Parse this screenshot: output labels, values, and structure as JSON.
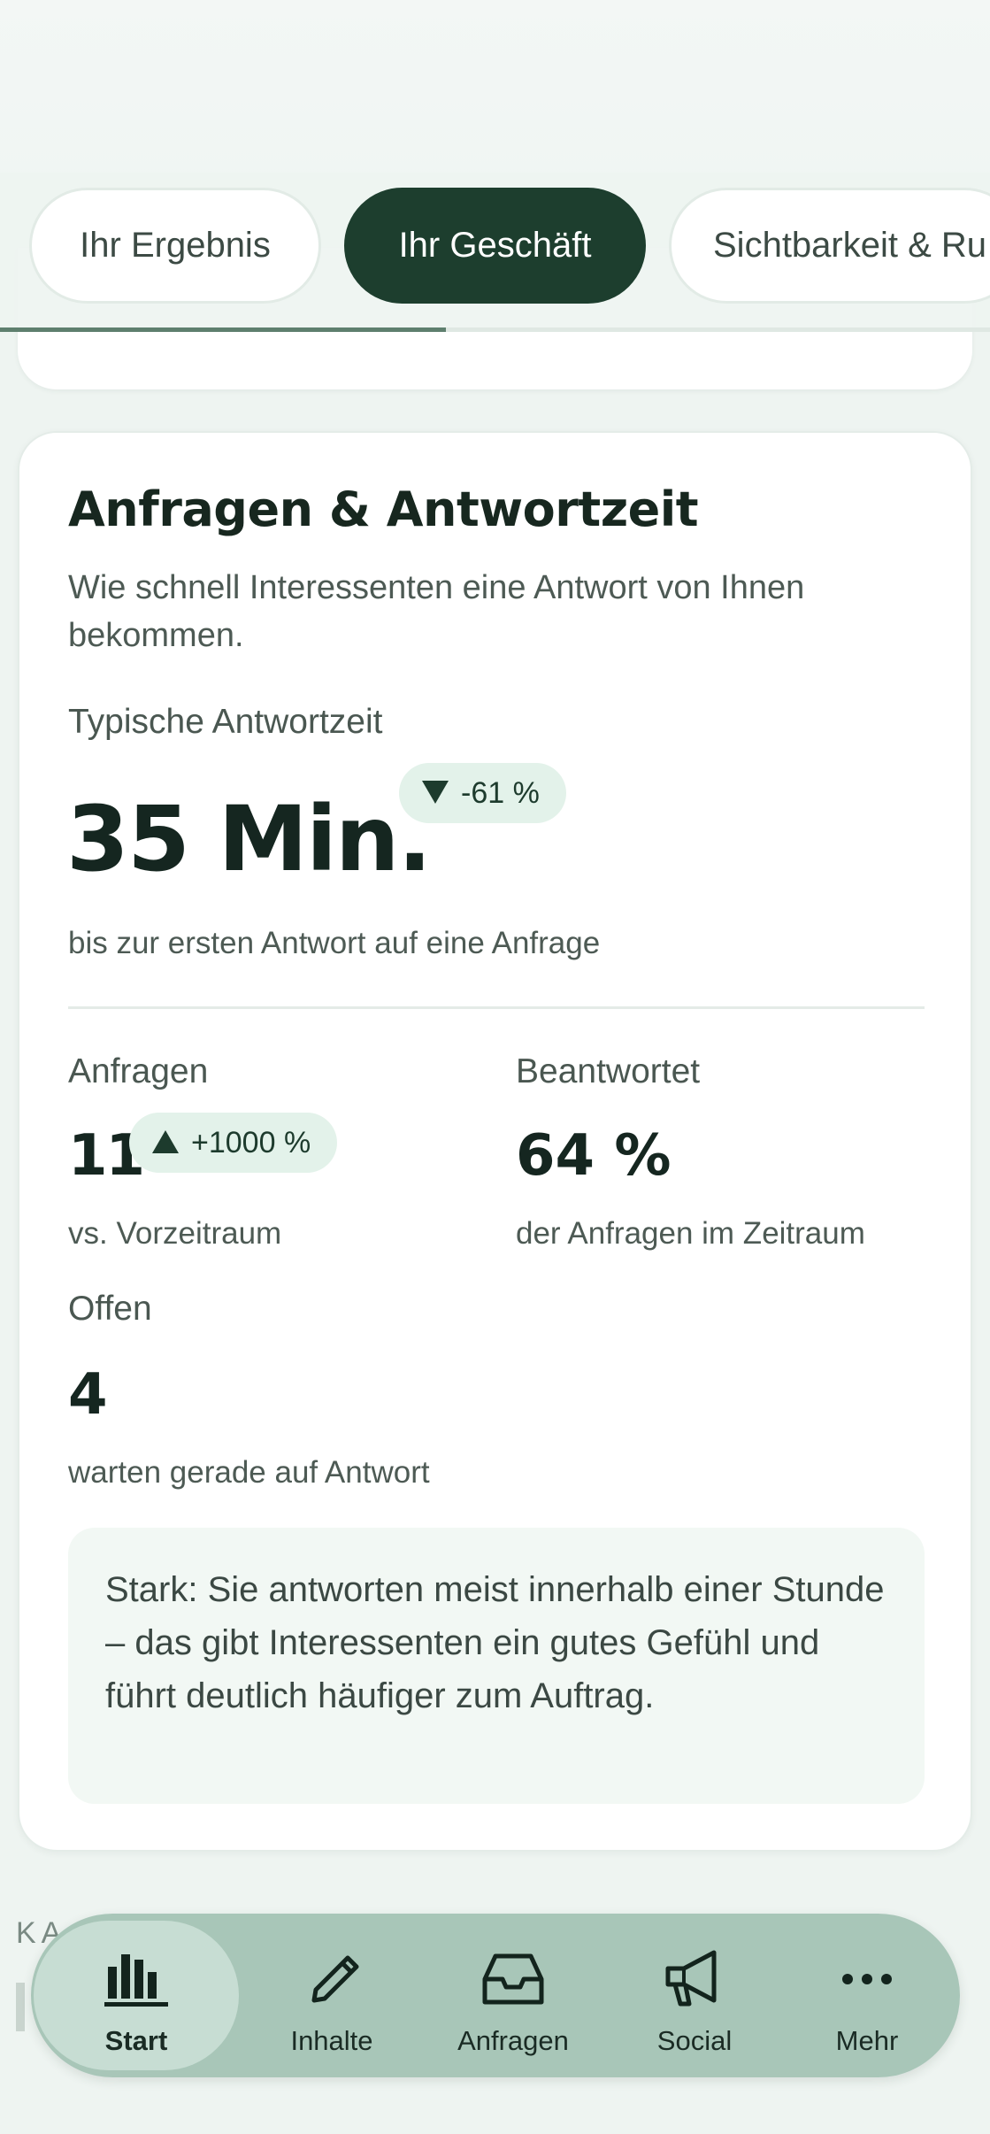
{
  "tabs": {
    "items": [
      {
        "label": ""
      },
      {
        "label": "Ihr Ergebnis"
      },
      {
        "label": "Ihr Geschäft"
      },
      {
        "label": "Sichtbarkeit & Ru"
      }
    ],
    "active_index": 2,
    "scroll_progress": 0.45
  },
  "card": {
    "title": "Anfragen & Antwortzeit",
    "subtitle": "Wie schnell Interessenten eine Antwort von Ihnen bekommen.",
    "response": {
      "label": "Typische Antwortzeit",
      "value": "35 Min.",
      "change": "-61 %",
      "change_direction": "down",
      "caption": "bis zur ersten Antwort auf eine Anfrage"
    },
    "requests": {
      "label": "Anfragen",
      "value": "11",
      "change": "+1000 %",
      "change_direction": "up",
      "caption": "vs. Vorzeitraum"
    },
    "answered": {
      "label": "Beantwortet",
      "value": "64 %",
      "caption": "der Anfragen im Zeitraum"
    },
    "open": {
      "label": "Offen",
      "value": "4",
      "caption": "warten gerade auf Antwort"
    },
    "note": "Stark: Sie antworten meist innerhalb einer Stunde – das gibt Interessenten ein gutes Gefühl und führt deutlich häufiger zum Auftrag."
  },
  "section_hint": "KA",
  "colors": {
    "accent_dark": "#1d3e2e",
    "badge_bg": "#e3f2ea",
    "nav_bg": "#a8c6b8",
    "nav_active_bg": "#c7ddd3"
  },
  "bottom_nav": {
    "items": [
      {
        "label": "Start",
        "icon": "bar-chart-icon",
        "active": true
      },
      {
        "label": "Inhalte",
        "icon": "pencil-icon",
        "active": false
      },
      {
        "label": "Anfragen",
        "icon": "inbox-icon",
        "active": false
      },
      {
        "label": "Social",
        "icon": "megaphone-icon",
        "active": false
      },
      {
        "label": "Mehr",
        "icon": "more-dots-icon",
        "active": false
      }
    ]
  }
}
